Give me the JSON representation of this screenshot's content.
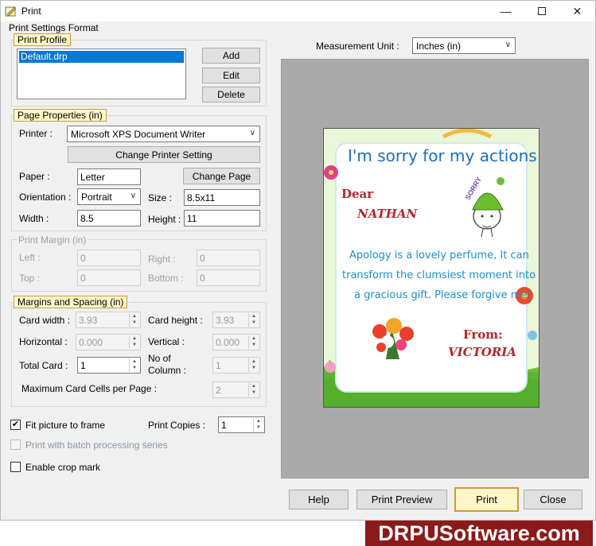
{
  "window": {
    "title": "Print",
    "minimize_icon": "minimize-icon",
    "maximize_icon": "maximize-icon",
    "close_icon": "close-icon"
  },
  "settings_format_label": "Print Settings Format",
  "print_profile": {
    "legend": "Print Profile",
    "items": [
      "Default.drp"
    ],
    "add_label": "Add",
    "edit_label": "Edit",
    "delete_label": "Delete"
  },
  "page_properties": {
    "legend": "Page Properties  (in)",
    "printer_label": "Printer :",
    "printer_value": "Microsoft XPS Document Writer",
    "change_printer_label": "Change Printer Setting",
    "paper_label": "Paper :",
    "paper_value": "Letter",
    "change_page_label": "Change Page",
    "orientation_label": "Orientation :",
    "orientation_value": "Portrait",
    "size_label": "Size :",
    "size_value": "8.5x11",
    "width_label": "Width :",
    "width_value": "8.5",
    "height_label": "Height :",
    "height_value": "11"
  },
  "print_margin": {
    "legend": "Print Margin (in)",
    "left_label": "Left :",
    "left_value": "0",
    "right_label": "Right :",
    "right_value": "0",
    "top_label": "Top :",
    "top_value": "0",
    "bottom_label": "Bottom :",
    "bottom_value": "0"
  },
  "margins_spacing": {
    "legend": "Margins and Spacing  (in)",
    "card_width_label": "Card width :",
    "card_width_value": "3.93",
    "card_height_label": "Card height :",
    "card_height_value": "3.93",
    "horizontal_label": "Horizontal :",
    "horizontal_value": "0.000",
    "vertical_label": "Vertical :",
    "vertical_value": "0.000",
    "total_card_label": "Total Card :",
    "total_card_value": "1",
    "no_of_column_label_1": "No of",
    "no_of_column_label_2": "Column :",
    "no_of_column_value": "1",
    "max_cells_label": "Maximum Card Cells per Page :",
    "max_cells_value": "2"
  },
  "options": {
    "fit_picture_label": "Fit picture to frame",
    "fit_picture_checked": true,
    "print_copies_label": "Print Copies :",
    "print_copies_value": "1",
    "batch_label": "Print with batch processing series",
    "crop_mark_label": "Enable crop mark"
  },
  "measurement": {
    "label": "Measurement Unit :",
    "value": "Inches (in)"
  },
  "card_preview": {
    "headline": "I'm sorry for my actions",
    "dear": "Dear",
    "to_name": "NATHAN",
    "sorry_tag": "SORRY",
    "message_line1": "Apology is a lovely perfume, It can",
    "message_line2": "transform the clumsiest moment into",
    "message_line3": "a gracious gift. Please forgive me!",
    "from": "From:",
    "from_name": "VICTORIA"
  },
  "footer": {
    "help_label": "Help",
    "preview_label": "Print Preview",
    "print_label": "Print",
    "close_label": "Close"
  },
  "brand": "DRPUSoftware.com",
  "colors": {
    "accent_border": "#d09b39",
    "accent_fill": "#fff7c8",
    "headline_blue": "#1a6fc0",
    "name_red": "#b3262a",
    "brand_bg": "#8b1a1a"
  }
}
